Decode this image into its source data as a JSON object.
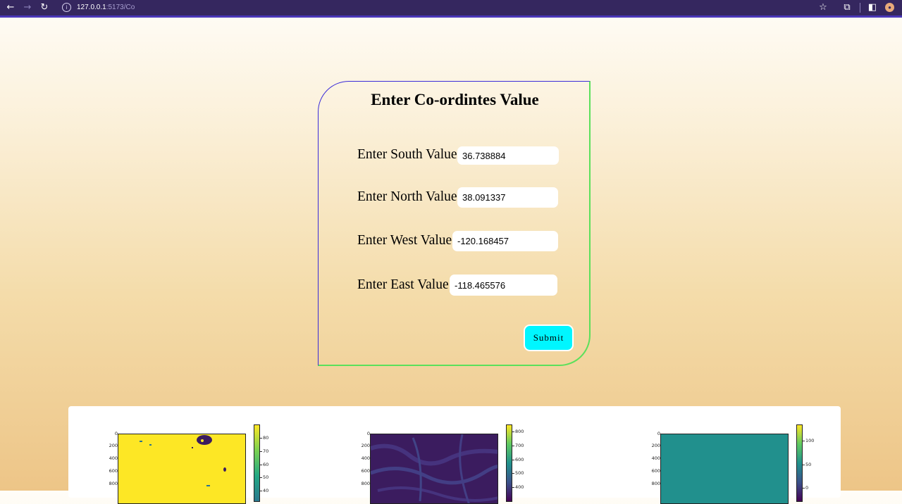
{
  "browser": {
    "url_host": "127.0.0.1",
    "url_path": ":5173/Co"
  },
  "form": {
    "title": "Enter Co-ordintes Value",
    "south_label": "Enter South Value :",
    "south_value": "36.738884",
    "north_label": "Enter North Value :",
    "north_value": "38.091337",
    "west_label": "Enter West Value :",
    "west_value": "-120.168457",
    "east_label": "Enter East Value :",
    "east_value": "-118.465576",
    "submit_label": "Submit"
  },
  "colors": {
    "submit_bg": "#00f6ff",
    "card_border_top_left": "#3a2bd8",
    "card_border_bottom_right": "#5be05b",
    "chrome_bg": "#35275f"
  },
  "plots": [
    {
      "y_ticks": [
        "0",
        "200",
        "400",
        "600",
        "800"
      ],
      "colorbar_ticks": [
        "80",
        "70",
        "60",
        "50",
        "40"
      ],
      "fill": "#fde725"
    },
    {
      "y_ticks": [
        "0",
        "200",
        "400",
        "600",
        "800"
      ],
      "colorbar_ticks": [
        "800",
        "700",
        "600",
        "500",
        "400"
      ],
      "fill": "#3b1c5f"
    },
    {
      "y_ticks": [
        "0",
        "200",
        "400",
        "600",
        "800"
      ],
      "colorbar_ticks": [
        "100",
        "50",
        "0"
      ],
      "fill": "#21908d"
    }
  ]
}
